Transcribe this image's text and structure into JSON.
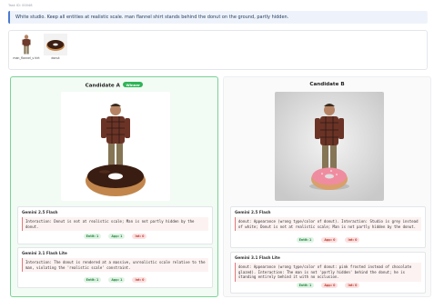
{
  "task_id": "Task ID: 00048",
  "prompt": "White studio. Keep all entities at realistic scale. man flannel shirt stands behind the donut on the ground, partly hidden.",
  "references": [
    {
      "label": "man_flannel_s hirt"
    },
    {
      "label": "donut"
    }
  ],
  "candidates": [
    {
      "title": "Candidate A",
      "badge": "Winner",
      "judges": [
        {
          "model": "Gemini 2.5 Flash",
          "text": "Interaction: Donut is not at realistic scale; Man is not partly hidden by the donut.",
          "pills": [
            {
              "label": "Entit: 1",
              "status": "ok"
            },
            {
              "label": "App: 1",
              "status": "ok"
            },
            {
              "label": "Int: 0",
              "status": "bad"
            }
          ]
        },
        {
          "model": "Gemini 3.1 Flash Lite",
          "text": "Interaction: The donut is rendered at a massive, unrealistic scale relative to the man, violating the 'realistic scale' constraint.",
          "pills": [
            {
              "label": "Entit: 1",
              "status": "ok"
            },
            {
              "label": "App: 1",
              "status": "ok"
            },
            {
              "label": "Int: 0",
              "status": "bad"
            }
          ]
        }
      ]
    },
    {
      "title": "Candidate B",
      "badge": "",
      "judges": [
        {
          "model": "Gemini 2.5 Flash",
          "text": "donut: Appearance (wrong type/color of donut). Interaction: Studio is grey instead of white; Donut is not at realistic scale; Man is not partly hidden by the donut.",
          "pills": [
            {
              "label": "Entit: 1",
              "status": "ok"
            },
            {
              "label": "App: 0",
              "status": "bad"
            },
            {
              "label": "Int: 0",
              "status": "bad"
            }
          ]
        },
        {
          "model": "Gemini 3.1 Flash Lite",
          "text": "donut: Appearance (wrong type/color of donut: pink frosted instead of chocolate glazed). Interaction: The man is not 'partly hidden' behind the donut; he is standing entirely behind it with no occlusion.",
          "pills": [
            {
              "label": "Entit: 1",
              "status": "ok"
            },
            {
              "label": "App: 0",
              "status": "bad"
            },
            {
              "label": "Int: 0",
              "status": "bad"
            }
          ]
        }
      ]
    }
  ]
}
